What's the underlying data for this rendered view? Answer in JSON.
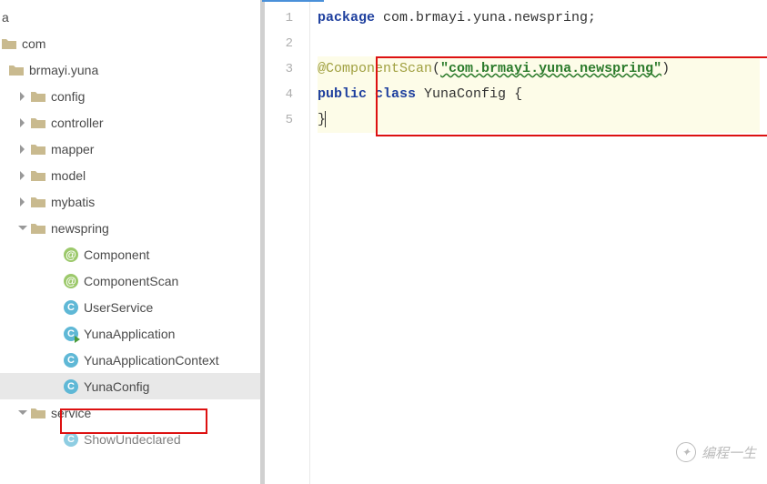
{
  "tree": {
    "root_a": "a",
    "root_com": "com",
    "brmayi": "brmayi.yuna",
    "config": "config",
    "controller": "controller",
    "mapper": "mapper",
    "model": "model",
    "mybatis": "mybatis",
    "newspring": "newspring",
    "component": "Component",
    "componentscan": "ComponentScan",
    "userservice": "UserService",
    "yunaapp": "YunaApplication",
    "yunaappctx": "YunaApplicationContext",
    "yunaconfig": "YunaConfig",
    "service": "service",
    "showundeclared": "ShowUndeclared"
  },
  "gutter": [
    "1",
    "2",
    "3",
    "4",
    "5"
  ],
  "code": {
    "pkg_kw": "package",
    "pkg_name": " com.brmayi.yuna.newspring;",
    "ann": "@ComponentScan",
    "ann_paren_l": "(",
    "ann_str": "\"com.brmayi.yuna.newspring\"",
    "ann_paren_r": ")",
    "public": "public ",
    "class_kw": "class ",
    "class_name": "YunaConfig ",
    "brace_l": "{",
    "brace_r": "}"
  },
  "watermark": "编程一生"
}
